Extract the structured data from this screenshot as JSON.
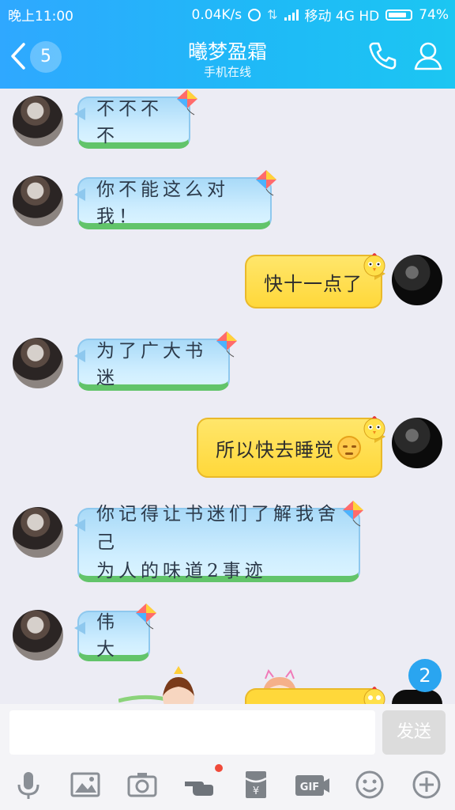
{
  "status_bar": {
    "time": "晚上11:00",
    "net_speed": "0.04K/s",
    "carrier": "移动 4G HD",
    "battery": "74%"
  },
  "header": {
    "back_count": "5",
    "title": "曦梦盈霜",
    "subtitle": "手机在线"
  },
  "messages": [
    {
      "side": "left",
      "text": "不不不不"
    },
    {
      "side": "left",
      "text": "你不能这么对我！"
    },
    {
      "side": "right",
      "text": "快十一点了"
    },
    {
      "side": "left",
      "text": "为了广大书迷"
    },
    {
      "side": "right",
      "text": "所以快去睡觉"
    },
    {
      "side": "left",
      "lines": [
        "你记得让书迷们了解我舍己",
        "为人的味道2事迹"
      ]
    },
    {
      "side": "left",
      "text": "伟大"
    }
  ],
  "unread_badge": "2",
  "input": {
    "placeholder": "",
    "send_label": "发送"
  },
  "toolbar": {
    "gif_label": "GIF"
  },
  "colors": {
    "header_start": "#2fa8ff",
    "header_end": "#1cc6f2",
    "left_bubble": "#cfeeff",
    "right_bubble": "#ffd83a",
    "background": "#ececf4"
  },
  "icons": [
    "back-arrow-icon",
    "phone-icon",
    "person-icon",
    "microphone-icon",
    "image-icon",
    "camera-icon",
    "poke-hand-icon",
    "red-packet-icon",
    "gif-icon",
    "emoji-icon",
    "plus-icon",
    "kite-icon",
    "chick-icon",
    "sad-face-emoji"
  ]
}
